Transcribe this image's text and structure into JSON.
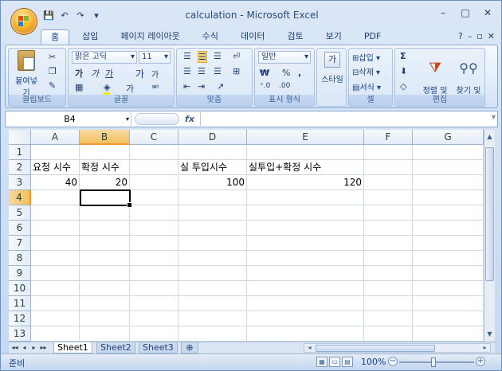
{
  "window": {
    "title": "calculation - Microsoft Excel",
    "controls": [
      "–",
      "□",
      "✕"
    ]
  },
  "qat": [
    "💾",
    "↶",
    "↷",
    "▾"
  ],
  "tabs": [
    "홈",
    "삽입",
    "페이지 레이아웃",
    "수식",
    "데이터",
    "검토",
    "보기",
    "PDF"
  ],
  "tab_right": [
    "?",
    "–",
    "▫",
    "✕"
  ],
  "ribbon": {
    "clipboard": {
      "paste": "붙여넣기",
      "label": "클립보드"
    },
    "font": {
      "name": "맑은 고딕",
      "size": "11",
      "label": "글꼴",
      "bold": "가",
      "italic": "가",
      "underline": "가",
      "grow": "가",
      "shrink": "가",
      "color_label": "가"
    },
    "align": {
      "label": "맞춤"
    },
    "number": {
      "format": "일반",
      "label": "표시 형식",
      "currency": "₩",
      "percent": "%",
      "comma": ","
    },
    "styles": {
      "label": "스타일"
    },
    "cells": {
      "insert": "삽입",
      "delete": "삭제",
      "format": "서식",
      "label": "셀"
    },
    "editing": {
      "sort": "정렬 및\n필터",
      "find": "찾기 및\n선택",
      "label": "편집",
      "sigma": "Σ"
    }
  },
  "formula_bar": {
    "name_box": "B4",
    "fx": "fx",
    "value": ""
  },
  "columns": [
    "A",
    "B",
    "C",
    "D",
    "E",
    "F",
    "G"
  ],
  "rows": [
    "1",
    "2",
    "3",
    "4",
    "5",
    "6",
    "7",
    "8",
    "9",
    "10",
    "11",
    "12",
    "13"
  ],
  "cells": {
    "A2": "요청 시수",
    "B2": "확정 시수",
    "D2": "실 투입시수",
    "E2": "실투입+확정 시수",
    "A3": "40",
    "B3": "20",
    "D3": "100",
    "E3": "120"
  },
  "selected_cell": "B4",
  "sheets": [
    "Sheet1",
    "Sheet2",
    "Sheet3"
  ],
  "active_sheet": "Sheet1",
  "status": {
    "ready": "준비",
    "zoom": "100%"
  }
}
